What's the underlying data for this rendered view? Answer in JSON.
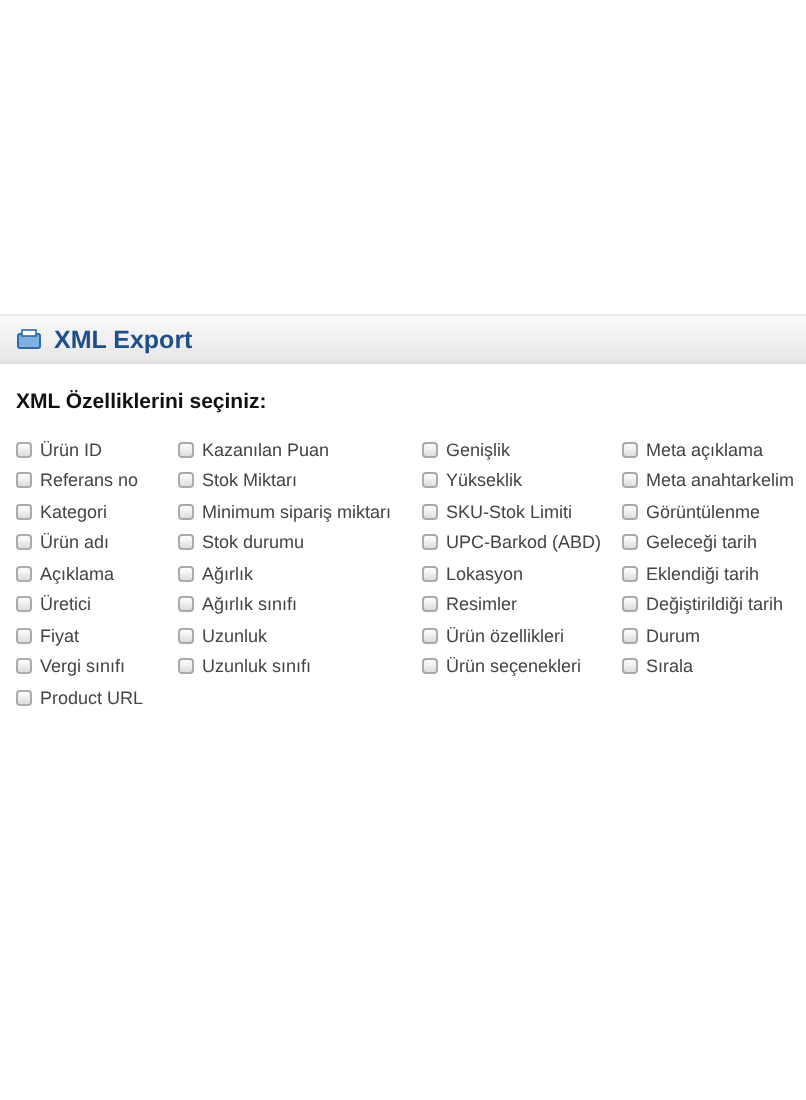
{
  "panel": {
    "title": "XML Export"
  },
  "section_title": "XML Özelliklerini seçiniz:",
  "columns": [
    [
      {
        "label": "Ürün ID",
        "checked": false
      },
      {
        "label": "Referans no",
        "checked": false
      },
      {
        "label": "Kategori",
        "checked": false
      },
      {
        "label": "Ürün adı",
        "checked": false
      },
      {
        "label": "Açıklama",
        "checked": false
      },
      {
        "label": "Üretici",
        "checked": false
      },
      {
        "label": "Fiyat",
        "checked": false
      },
      {
        "label": "Vergi sınıfı",
        "checked": false
      },
      {
        "label": "Product URL",
        "checked": false
      }
    ],
    [
      {
        "label": "Kazanılan Puan",
        "checked": false
      },
      {
        "label": "Stok Miktarı",
        "checked": false
      },
      {
        "label": "Minimum sipariş miktarı",
        "checked": false
      },
      {
        "label": "Stok durumu",
        "checked": false
      },
      {
        "label": "Ağırlık",
        "checked": false
      },
      {
        "label": "Ağırlık sınıfı",
        "checked": false
      },
      {
        "label": "Uzunluk",
        "checked": false
      },
      {
        "label": "Uzunluk sınıfı",
        "checked": false
      }
    ],
    [
      {
        "label": "Genişlik",
        "checked": false
      },
      {
        "label": "Yükseklik",
        "checked": false
      },
      {
        "label": "SKU-Stok Limiti",
        "checked": false
      },
      {
        "label": "UPC-Barkod (ABD)",
        "checked": false
      },
      {
        "label": "Lokasyon",
        "checked": false
      },
      {
        "label": "Resimler",
        "checked": false
      },
      {
        "label": "Ürün özellikleri",
        "checked": false
      },
      {
        "label": "Ürün seçenekleri",
        "checked": false
      }
    ],
    [
      {
        "label": "Meta açıklama",
        "checked": false
      },
      {
        "label": "Meta anahtarkelim",
        "checked": false
      },
      {
        "label": "Görüntülenme",
        "checked": false
      },
      {
        "label": "Geleceği tarih",
        "checked": false
      },
      {
        "label": "Eklendiği tarih",
        "checked": false
      },
      {
        "label": "Değiştirildiği tarih",
        "checked": false
      },
      {
        "label": "Durum",
        "checked": false
      },
      {
        "label": "Sırala",
        "checked": false
      }
    ]
  ]
}
